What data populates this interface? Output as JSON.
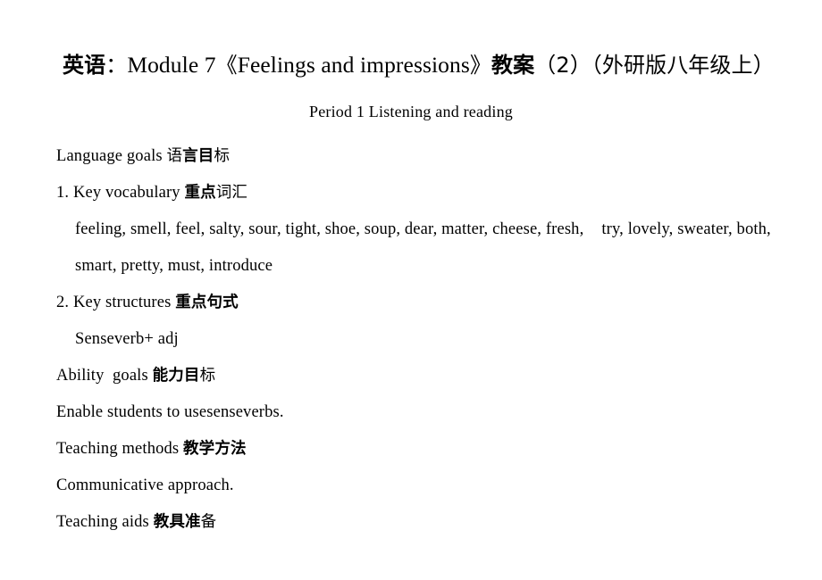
{
  "document": {
    "title": {
      "full": "英语：Module 7《Feelings and impressions》教案（2）（外研版八年级上）",
      "seg_subject": "英语",
      "seg_colon": "：",
      "seg_module": "Module 7",
      "seg_bracket_open": "《",
      "seg_unit_name": "Feelings and impressions",
      "seg_bracket_close": "》",
      "seg_doc_type": "教案",
      "seg_number": "（2）",
      "seg_edition": "（外研版八年级上）"
    },
    "subtitle": "Period 1 Listening and reading",
    "lines": [
      {
        "id": "language-goals",
        "indent": 0,
        "text": "Language goals 语言目标",
        "en": "Language goals ",
        "cn_bold": "言目",
        "cn_light_pre": "语",
        "cn_light_post": "标"
      },
      {
        "id": "key-vocabulary-heading",
        "indent": 0,
        "text": "1. Key vocabulary 重点词汇",
        "en": "1. Key vocabulary ",
        "cn_bold": "重点",
        "cn_light_post": "词汇"
      },
      {
        "id": "vocabulary-list-line-1",
        "indent": 1,
        "text": "feeling, smell, feel, salty, sour, tight, shoe, soup, dear, matter, cheese, fresh,    try, lovely, sweater, both,",
        "part_a": "feeling, smell, feel, salty, sour, tight, shoe, soup, dear, matter, cheese, fresh,",
        "part_b": "try, lovely, sweater, both,"
      },
      {
        "id": "vocabulary-list-line-2",
        "indent": 1,
        "text": "smart, pretty, must, introduce"
      },
      {
        "id": "key-structures-heading",
        "indent": 0,
        "text": "2. Key structures 重点句式",
        "en": "2. Key structures ",
        "cn_bold": "重点句式"
      },
      {
        "id": "key-structures-content",
        "indent": 1,
        "text": "Senseverb+ adj"
      },
      {
        "id": "ability-goals",
        "indent": 0,
        "text": "Ability  goals 能力目标",
        "en": "Ability  goals ",
        "cn_bold": "能力目",
        "cn_light_post": "标"
      },
      {
        "id": "ability-goals-content",
        "indent": 0,
        "text": "Enable students to usesenseverbs."
      },
      {
        "id": "teaching-methods",
        "indent": 0,
        "text": "Teaching methods 教学方法",
        "en": "Teaching methods ",
        "cn_bold": "教学方法"
      },
      {
        "id": "teaching-methods-content",
        "indent": 0,
        "text": "Communicative approach."
      },
      {
        "id": "teaching-aids",
        "indent": 0,
        "text": "Teaching aids 教具准备",
        "en": "Teaching aids ",
        "cn_bold": "教具准",
        "cn_light_post": "备"
      }
    ]
  },
  "style": {
    "page_background": "#ffffff",
    "text_color": "#000000"
  }
}
